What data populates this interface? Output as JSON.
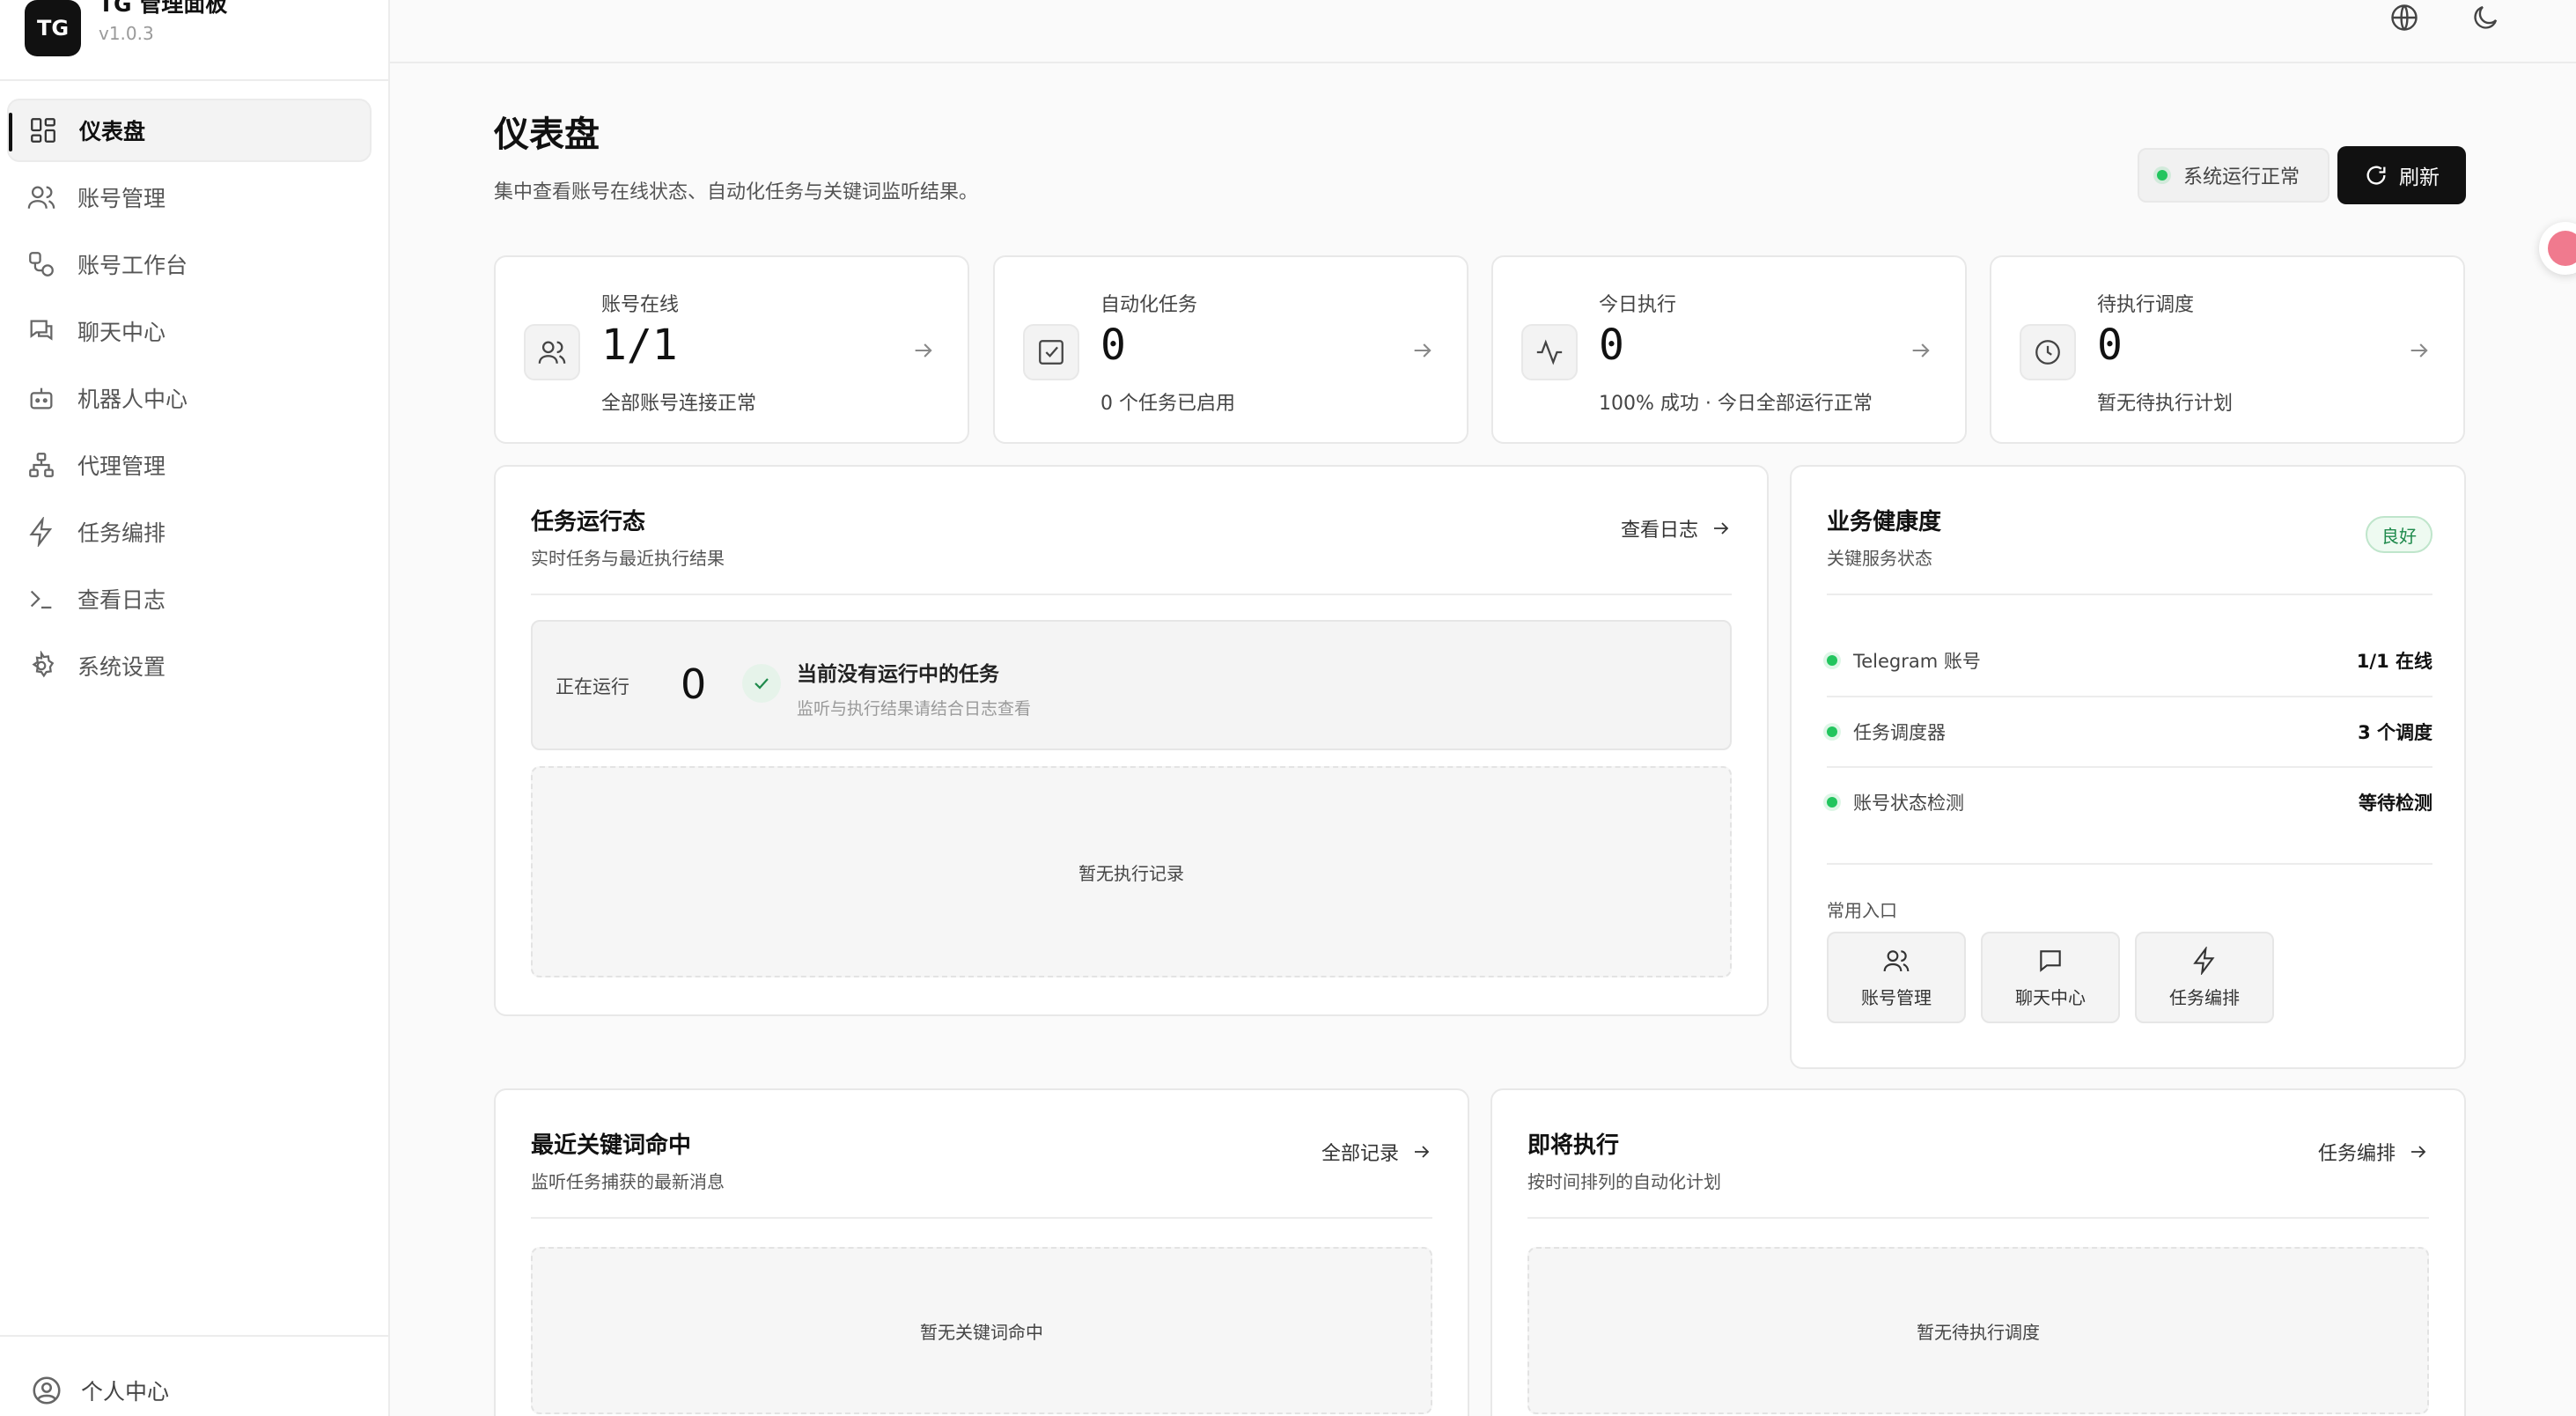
{
  "app": {
    "logo_text": "TG",
    "name": "TG 管理面板",
    "version": "v1.0.3"
  },
  "sidebar": {
    "items": [
      {
        "label": "仪表盘",
        "icon": "dashboard-icon",
        "active": true
      },
      {
        "label": "账号管理",
        "icon": "users-icon"
      },
      {
        "label": "账号工作台",
        "icon": "workspace-icon"
      },
      {
        "label": "聊天中心",
        "icon": "chat-icon"
      },
      {
        "label": "机器人中心",
        "icon": "bot-icon"
      },
      {
        "label": "代理管理",
        "icon": "network-icon"
      },
      {
        "label": "任务编排",
        "icon": "bolt-icon"
      },
      {
        "label": "查看日志",
        "icon": "terminal-icon"
      },
      {
        "label": "系统设置",
        "icon": "gear-icon"
      }
    ],
    "profile_label": "个人中心"
  },
  "topbar": {
    "icons": [
      "globe-icon",
      "moon-icon"
    ]
  },
  "header": {
    "title": "仪表盘",
    "subtitle": "集中查看账号在线状态、自动化任务与关键词监听结果。",
    "status_text": "系统运行正常",
    "refresh_label": "刷新"
  },
  "stats": [
    {
      "label": "账号在线",
      "value": "1/1",
      "desc": "全部账号连接正常",
      "icon": "users-icon"
    },
    {
      "label": "自动化任务",
      "value": "0",
      "desc": "0 个任务已启用",
      "icon": "checkbox-icon"
    },
    {
      "label": "今日执行",
      "value": "0",
      "desc": "100% 成功 · 今日全部运行正常",
      "icon": "activity-icon"
    },
    {
      "label": "待执行调度",
      "value": "0",
      "desc": "暂无待执行计划",
      "icon": "clock-icon"
    }
  ],
  "task_panel": {
    "title": "任务运行态",
    "subtitle": "实时任务与最近执行结果",
    "link": "查看日志",
    "running_label": "正在运行",
    "running_value": "0",
    "running_title": "当前没有运行中的任务",
    "running_sub": "监听与执行结果请结合日志查看",
    "empty": "暂无执行记录"
  },
  "health_panel": {
    "title": "业务健康度",
    "subtitle": "关键服务状态",
    "badge": "良好",
    "rows": [
      {
        "label": "Telegram 账号",
        "value": "1/1 在线"
      },
      {
        "label": "任务调度器",
        "value": "3 个调度"
      },
      {
        "label": "账号状态检测",
        "value": "等待检测"
      }
    ],
    "quick_title": "常用入口",
    "quick": [
      {
        "label": "账号管理",
        "icon": "users-icon"
      },
      {
        "label": "聊天中心",
        "icon": "chat-icon"
      },
      {
        "label": "任务编排",
        "icon": "bolt-icon"
      }
    ]
  },
  "keyword_panel": {
    "title": "最近关键词命中",
    "subtitle": "监听任务捕获的最新消息",
    "link": "全部记录",
    "empty": "暂无关键词命中"
  },
  "upcoming_panel": {
    "title": "即将执行",
    "subtitle": "按时间排列的自动化计划",
    "link": "任务编排",
    "empty": "暂无待执行调度"
  },
  "colors": {
    "accent": "#111111",
    "success": "#22c55e",
    "border": "#e8e8e8"
  }
}
